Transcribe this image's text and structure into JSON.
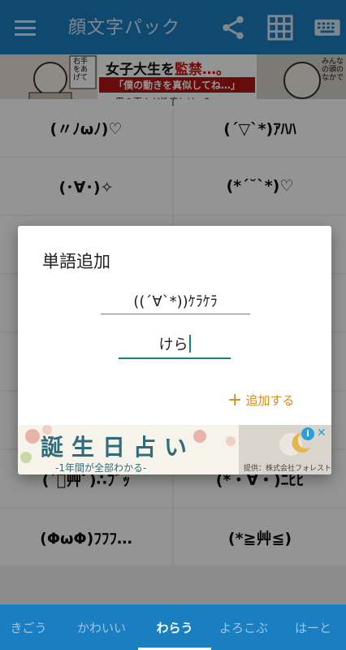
{
  "appbar": {
    "title": "顔文字パック",
    "color": "#1a7fc0"
  },
  "banner": {
    "headline": "女子大生を",
    "headline_highlight": "監禁…。",
    "quote": "「僕の動きを真似してね…」",
    "subline": "男の歪んだ性癖とは…？",
    "speech_left": "右手をあげて",
    "speech_right": "みんなの頭のなかで"
  },
  "grid": {
    "cells": [
      "(〃ﾉωﾉ)♡",
      "(´▽`*)ｱﾊﾊ",
      "(･∀･)✧",
      "(*´˘`*)♡",
      "",
      "",
      "",
      "",
      "",
      "",
      "",
      "",
      "(´ﾟ艸ﾟ)∴ﾌﾞｯ",
      "(*・∀・)ﾆﾋﾋ",
      "(ΦωΦ)ﾌﾌﾌ…",
      "(*≧艸≦)"
    ]
  },
  "dialog": {
    "title": "単語追加",
    "emoticon_value": "((´∀`*))ｹﾗｹﾗ",
    "reading_value": "けら",
    "add_label": "追加する"
  },
  "ad": {
    "title": "誕生日占い",
    "subtitle": "-1年間が全部わかる-",
    "provider": "提供：株式会社フォレスト",
    "info_mark": "i",
    "close_mark": "✕"
  },
  "bottom_nav": {
    "tabs": [
      "きごう",
      "かわいい",
      "わらう",
      "よろこぶ",
      "はーと"
    ],
    "active_index": 2
  }
}
